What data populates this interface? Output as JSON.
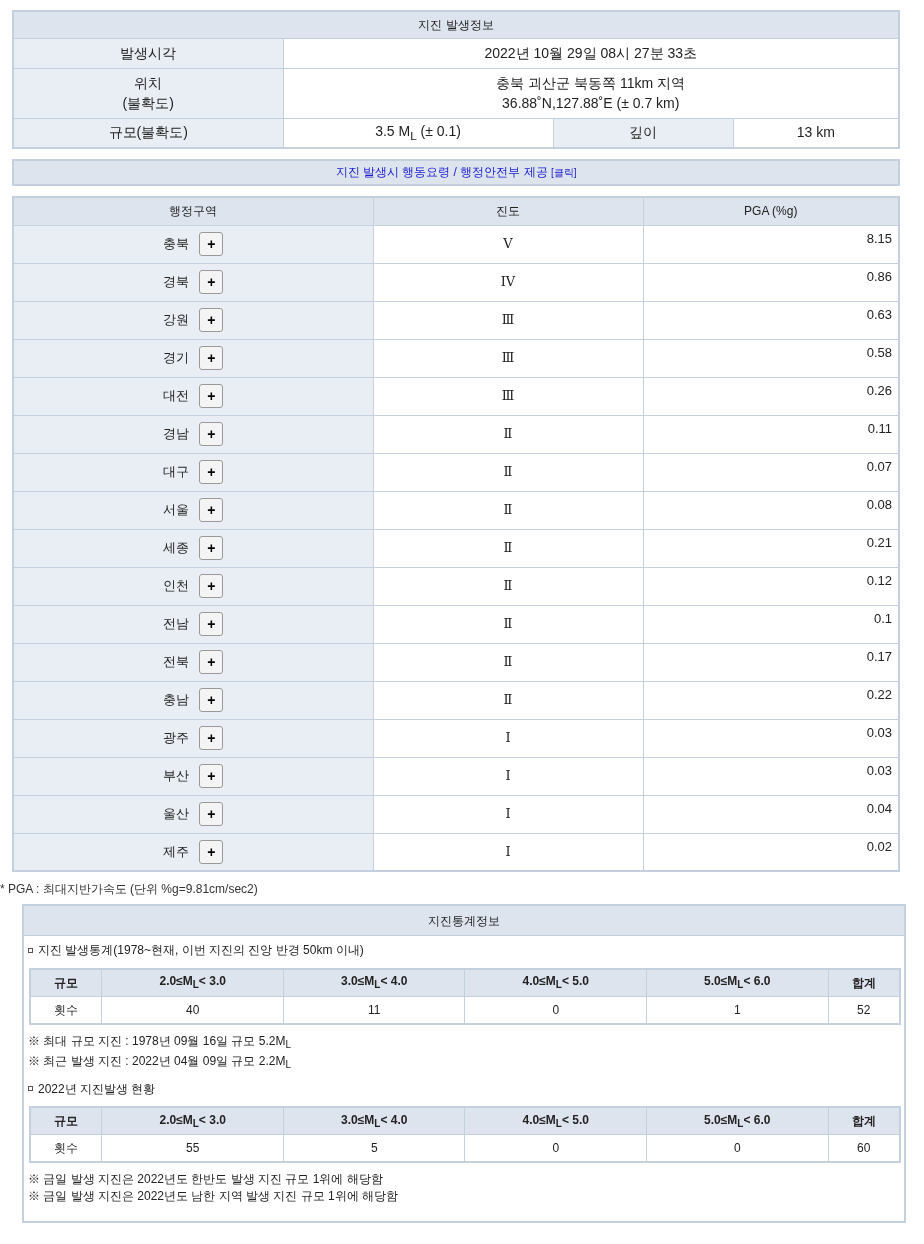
{
  "info": {
    "title": "지진 발생정보",
    "time": {
      "label": "발생시각",
      "value": "2022년 10월 29일 08시 27분 33초"
    },
    "location": {
      "label": "위치",
      "label_note": "(불확도)",
      "value": "충북 괴산군 북동쪽 11km 지역",
      "coords": "36.88˚N,127.88˚E (± 0.7 km)"
    },
    "magnitude": {
      "label": "규모(불확도)",
      "value": "3.5 M$_{L}$ (± 0.1)",
      "depth_label": "깊이",
      "depth_value": "13 km"
    }
  },
  "guide_link": {
    "text": "지진 발생시 행동요령 / 행정안전부 제공",
    "badge": "[클릭]"
  },
  "regions": {
    "columns": [
      "행정구역",
      "진도",
      "PGA (%g)"
    ],
    "rows": [
      {
        "name": "충북",
        "button": "+",
        "intensity": "V",
        "pga": "8.15"
      },
      {
        "name": "경북",
        "button": "+",
        "intensity": "IV",
        "pga": "0.86"
      },
      {
        "name": "강원",
        "button": "+",
        "intensity": "Ⅲ",
        "pga": "0.63"
      },
      {
        "name": "경기",
        "button": "+",
        "intensity": "Ⅲ",
        "pga": "0.58"
      },
      {
        "name": "대전",
        "button": "+",
        "intensity": "Ⅲ",
        "pga": "0.26"
      },
      {
        "name": "경남",
        "button": "+",
        "intensity": "Ⅱ",
        "pga": "0.11"
      },
      {
        "name": "대구",
        "button": "+",
        "intensity": "Ⅱ",
        "pga": "0.07"
      },
      {
        "name": "서울",
        "button": "+",
        "intensity": "Ⅱ",
        "pga": "0.08"
      },
      {
        "name": "세종",
        "button": "+",
        "intensity": "Ⅱ",
        "pga": "0.21"
      },
      {
        "name": "인천",
        "button": "+",
        "intensity": "Ⅱ",
        "pga": "0.12"
      },
      {
        "name": "전남",
        "button": "+",
        "intensity": "Ⅱ",
        "pga": "0.1"
      },
      {
        "name": "전북",
        "button": "+",
        "intensity": "Ⅱ",
        "pga": "0.17"
      },
      {
        "name": "충남",
        "button": "+",
        "intensity": "Ⅱ",
        "pga": "0.22"
      },
      {
        "name": "광주",
        "button": "+",
        "intensity": "Ⅰ",
        "pga": "0.03"
      },
      {
        "name": "부산",
        "button": "+",
        "intensity": "Ⅰ",
        "pga": "0.03"
      },
      {
        "name": "울산",
        "button": "+",
        "intensity": "Ⅰ",
        "pga": "0.04"
      },
      {
        "name": "제주",
        "button": "+",
        "intensity": "Ⅰ",
        "pga": "0.02"
      }
    ]
  },
  "pga_note": "* PGA : 최대지반가속도 (단위 %g=9.81cm/sec2)",
  "stats": {
    "title": "지진통계정보",
    "sections": [
      {
        "heading": "지진 발생통계(1978~현재, 이번 지진의 진앙 반경 50km 이내)",
        "columns": [
          "규모",
          "2.0≤M$_{L}$< 3.0",
          "3.0≤M$_{L}$< 4.0",
          "4.0≤M$_{L}$< 5.0",
          "5.0≤M$_{L}$< 6.0",
          "합계"
        ],
        "row": [
          "횟수",
          "40",
          "11",
          "0",
          "1",
          "52"
        ],
        "notes": [
          "※ 최대 규모 지진 : 1978년 09월 16일 규모 5.2M$_{L}$",
          "※ 최근 발생 지진 : 2022년 04월 09일 규모 2.2M$_{L}$"
        ]
      },
      {
        "heading": "2022년 지진발생 현황",
        "columns": [
          "규모",
          "2.0≤M$_{L}$< 3.0",
          "3.0≤M$_{L}$< 4.0",
          "4.0≤M$_{L}$< 5.0",
          "5.0≤M$_{L}$< 6.0",
          "합계"
        ],
        "row": [
          "횟수",
          "55",
          "5",
          "0",
          "0",
          "60"
        ],
        "notes": [
          "※ 금일 발생 지진은 2022년도 한반도 발생 지진 규모 1위에 해당함",
          "※ 금일 발생 지진은 2022년도 남한 지역 발생 지진 규모 1위에 해당함"
        ]
      }
    ]
  }
}
